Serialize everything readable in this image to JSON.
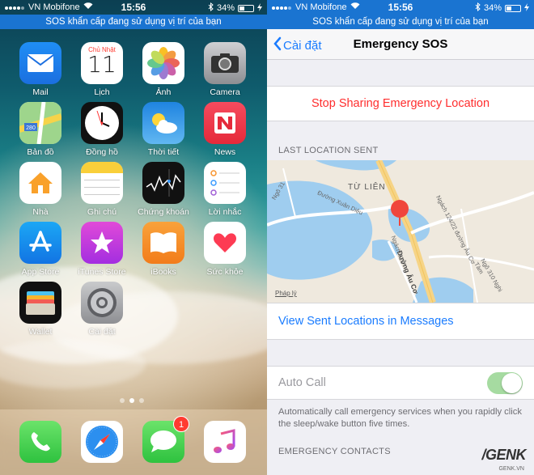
{
  "status": {
    "carrier": "VN Mobifone",
    "time": "15:56",
    "battery": "34%"
  },
  "sos_banner": "SOS khẩn cấp đang sử dụng vị trí của bạn",
  "home": {
    "apps": [
      {
        "label": "Mail",
        "icon": "mail-icon"
      },
      {
        "label": "Lịch",
        "icon": "calendar-icon",
        "weekday": "Chủ Nhật",
        "day": "11"
      },
      {
        "label": "Ảnh",
        "icon": "photos-icon"
      },
      {
        "label": "Camera",
        "icon": "camera-icon"
      },
      {
        "label": "Bản đồ",
        "icon": "maps-icon"
      },
      {
        "label": "Đồng hồ",
        "icon": "clock-icon"
      },
      {
        "label": "Thời tiết",
        "icon": "weather-icon"
      },
      {
        "label": "News",
        "icon": "news-icon"
      },
      {
        "label": "Nhà",
        "icon": "home-icon"
      },
      {
        "label": "Ghi chú",
        "icon": "notes-icon"
      },
      {
        "label": "Chứng khoán",
        "icon": "stocks-icon"
      },
      {
        "label": "Lời nhắc",
        "icon": "reminders-icon"
      },
      {
        "label": "App Store",
        "icon": "appstore-icon"
      },
      {
        "label": "iTunes Store",
        "icon": "itunes-icon"
      },
      {
        "label": "iBooks",
        "icon": "ibooks-icon"
      },
      {
        "label": "Sức khỏe",
        "icon": "health-icon"
      },
      {
        "label": "Wallet",
        "icon": "wallet-icon"
      },
      {
        "label": "Cài đặt",
        "icon": "settings-icon"
      }
    ],
    "dock": [
      {
        "icon": "phone-icon"
      },
      {
        "icon": "safari-icon"
      },
      {
        "icon": "messages-icon",
        "badge": "1"
      },
      {
        "icon": "music-icon"
      }
    ],
    "page_count": 3,
    "current_page": 2
  },
  "settings": {
    "back_label": "Cài đặt",
    "title": "Emergency SOS",
    "stop_sharing": "Stop Sharing Emergency Location",
    "last_location_header": "LAST LOCATION SENT",
    "map": {
      "area": "TỪ LIÊN",
      "streets": [
        "Ngõ 31",
        "Đường Xuân Diệu",
        "Đường Âu Cơ",
        "Ngách 124/22 đường Âu Cơ",
        "Ngách 715",
        "Ngõ 310 Nghi Tàm",
        "Pháp lý"
      ]
    },
    "view_sent": "View Sent Locations in Messages",
    "auto_call_label": "Auto Call",
    "auto_call_on": true,
    "auto_call_description": "Automatically call emergency services when you rapidly click the sleep/wake button five times.",
    "emergency_contacts_header": "EMERGENCY CONTACTS"
  },
  "watermark": {
    "brand": "/GENK",
    "site": "GENK.VN"
  },
  "colors": {
    "accent": "#1a7cff",
    "sos_bar": "#1a74d1",
    "destructive": "#ff2d2d",
    "toggle_on": "#a6dba1"
  }
}
